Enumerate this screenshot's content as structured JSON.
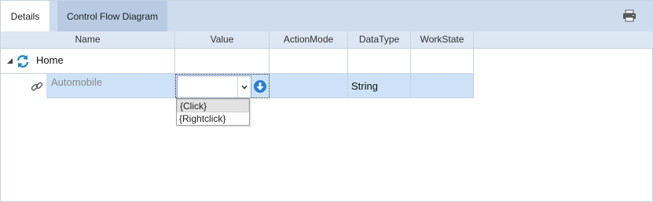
{
  "tabs": [
    {
      "label": "Details",
      "active": true
    },
    {
      "label": "Control Flow Diagram",
      "active": false
    }
  ],
  "toolbar": {
    "print_icon": "printer-icon"
  },
  "columns": [
    "Name",
    "Value",
    "ActionMode",
    "DataType",
    "WorkState"
  ],
  "rows": [
    {
      "name": "Home",
      "icon": "refresh-icon",
      "expanded": true,
      "value": "",
      "action_mode": "",
      "data_type": "",
      "work_state": ""
    },
    {
      "name": "Automobile",
      "icon": "link-icon",
      "value": "",
      "action_mode": "",
      "data_type": "String",
      "work_state": "",
      "selected": true
    }
  ],
  "editor": {
    "value": "",
    "dropdown_options": [
      "{Click}",
      "{Rightclick}"
    ]
  },
  "colors": {
    "tabstrip": "#cfdcee",
    "header": "#dde6f3",
    "selected_row": "#cde2f6",
    "icon_blue": "#2a7fd4",
    "refresh_blue": "#1e88c9"
  }
}
